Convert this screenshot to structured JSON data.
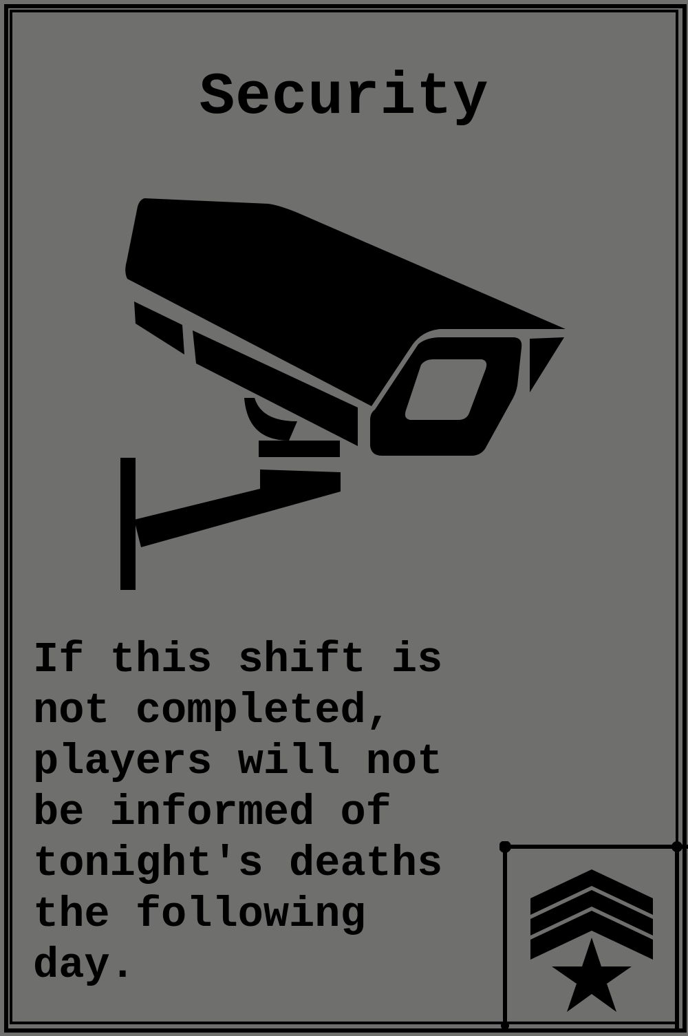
{
  "card": {
    "title": "Security",
    "description": "If this shift is\nnot completed,\nplayers will not\nbe informed of\ntonight's deaths\nthe following\nday.",
    "illustration_icon": "security-camera-icon",
    "rank_icon": "sergeant-chevron-star-icon"
  },
  "colors": {
    "background": "#6f706e",
    "ink": "#000000"
  }
}
